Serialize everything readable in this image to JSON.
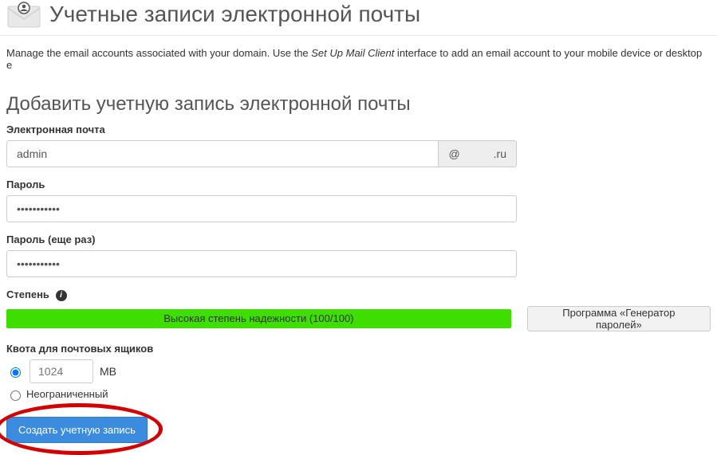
{
  "header": {
    "title": "Учетные записи электронной почты"
  },
  "description": {
    "prefix": "Manage the email accounts associated with your domain. Use the ",
    "link_text": "Set Up Mail Client",
    "suffix": " interface to add an email account to your mobile device or desktop e"
  },
  "section": {
    "title": "Добавить учетную запись электронной почты"
  },
  "email": {
    "label": "Электронная почта",
    "value": "admin",
    "at": "@",
    "domain": ".ru"
  },
  "password": {
    "label": "Пароль",
    "value": "•••••••••••"
  },
  "password_confirm": {
    "label": "Пароль (еще раз)",
    "value": "•••••••••••"
  },
  "strength": {
    "label": "Степень",
    "bar_text": "Высокая степень надежности (100/100)",
    "generator_button": "Программа «Генератор паролей»"
  },
  "quota": {
    "label": "Квота для почтовых ящиков",
    "value_placeholder": "1024",
    "unit": "MB",
    "unlimited_label": "Неограниченный"
  },
  "submit": {
    "label": "Создать учетную запись"
  }
}
